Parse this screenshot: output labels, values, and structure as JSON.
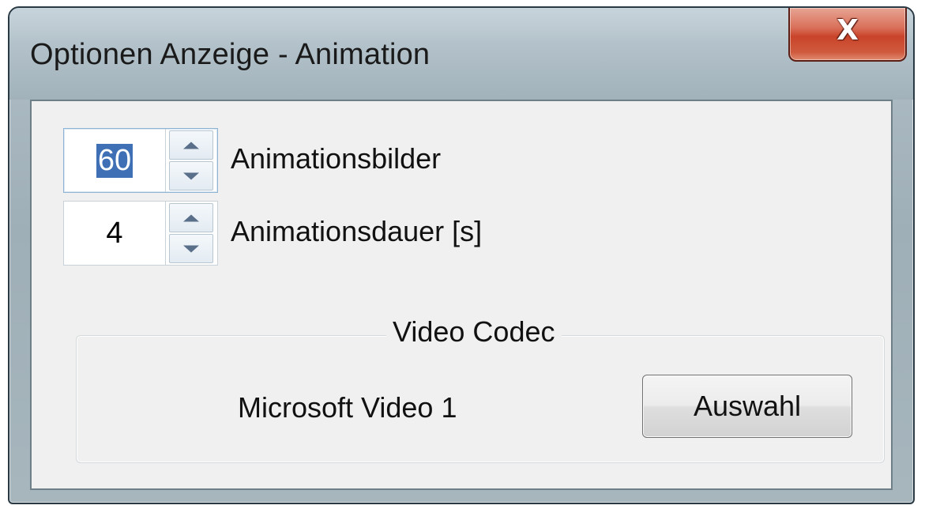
{
  "window": {
    "title": "Optionen Anzeige - Animation",
    "close_glyph": "X"
  },
  "animation_frames": {
    "value": "60",
    "label": "Animationsbilder"
  },
  "animation_duration": {
    "value": "4",
    "label": "Animationsdauer [s]"
  },
  "video_codec": {
    "group_title": "Video Codec",
    "codec_name": "Microsoft Video 1",
    "select_label": "Auswahl"
  },
  "icons": {
    "close": "close-icon",
    "spin_up": "chevron-up-icon",
    "spin_down": "chevron-down-icon"
  },
  "colors": {
    "close_button": "#c9442a",
    "selection": "#3f6fb4",
    "client_background": "#f0f0f0"
  }
}
